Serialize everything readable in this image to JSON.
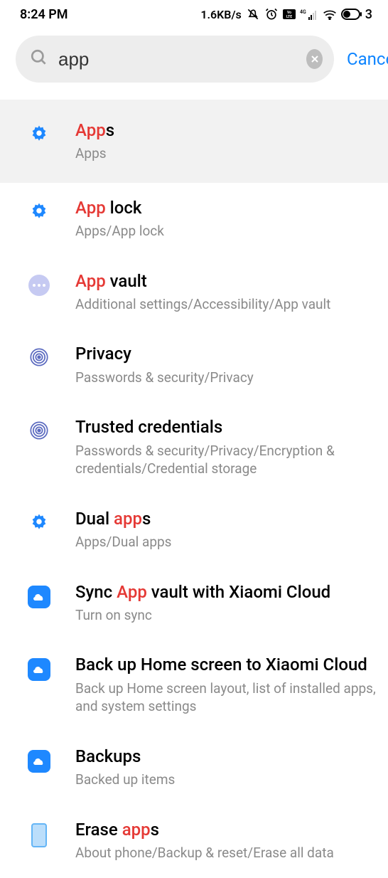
{
  "status": {
    "time": "8:24 PM",
    "speed": "1.6KB/s",
    "battery_suffix": "3"
  },
  "search": {
    "value": "app",
    "cancel": "Cancel"
  },
  "results": [
    {
      "pre": "",
      "hl": "App",
      "post": "s",
      "sub": "Apps",
      "icon": "gear",
      "highlighted": true
    },
    {
      "pre": "",
      "hl": "App",
      "post": " lock",
      "sub": "Apps/App lock",
      "icon": "gear"
    },
    {
      "pre": "",
      "hl": "App",
      "post": " vault",
      "sub": "Additional settings/Accessibility/App vault",
      "icon": "dots"
    },
    {
      "pre": "Privacy",
      "hl": "",
      "post": "",
      "sub": "Passwords & security/Privacy",
      "icon": "finger"
    },
    {
      "pre": "Trusted credentials",
      "hl": "",
      "post": "",
      "sub": "Passwords & security/Privacy/Encryption & credentials/Credential storage",
      "icon": "finger"
    },
    {
      "pre": "Dual ",
      "hl": "app",
      "post": "s",
      "sub": "Apps/Dual apps",
      "icon": "gear"
    },
    {
      "pre": "Sync ",
      "hl": "App",
      "post": " vault with Xiaomi Cloud",
      "sub": "Turn on sync",
      "icon": "cloud"
    },
    {
      "pre": "Back up Home screen to Xiaomi Cloud",
      "hl": "",
      "post": "",
      "sub": "Back up Home screen layout, list of installed apps, and system settings",
      "icon": "cloud"
    },
    {
      "pre": "Backups",
      "hl": "",
      "post": "",
      "sub": "Backed up items",
      "icon": "cloud"
    },
    {
      "pre": "Erase ",
      "hl": "app",
      "post": "s",
      "sub": "About phone/Backup & reset/Erase all data",
      "icon": "phone"
    }
  ]
}
